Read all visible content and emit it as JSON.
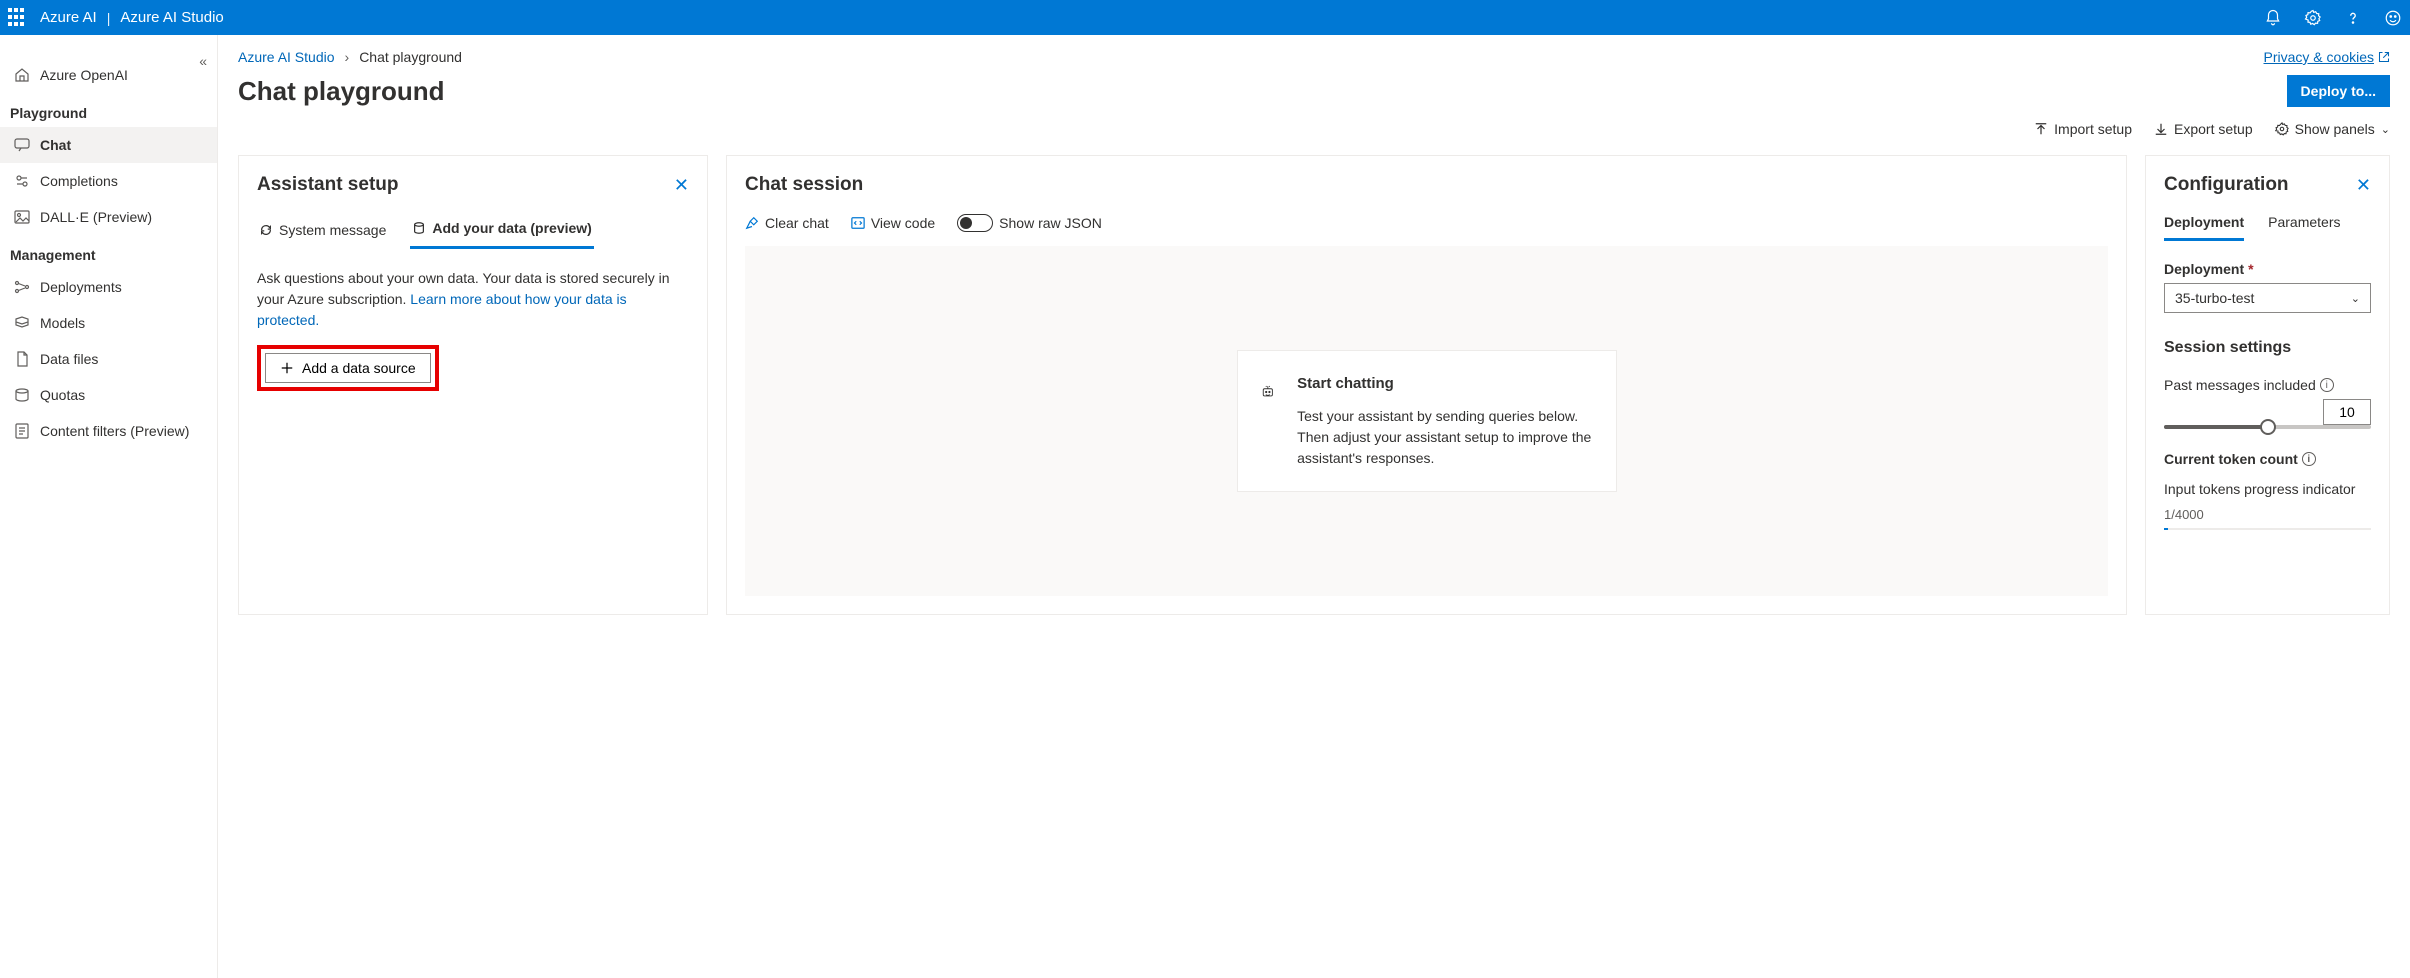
{
  "topbar": {
    "brand_left": "Azure AI",
    "brand_right": "Azure AI Studio"
  },
  "sidebar": {
    "openai": "Azure OpenAI",
    "heading_playground": "Playground",
    "items_playground": [
      {
        "label": "Chat"
      },
      {
        "label": "Completions"
      },
      {
        "label": "DALL·E (Preview)"
      }
    ],
    "heading_management": "Management",
    "items_management": [
      {
        "label": "Deployments"
      },
      {
        "label": "Models"
      },
      {
        "label": "Data files"
      },
      {
        "label": "Quotas"
      },
      {
        "label": "Content filters (Preview)"
      }
    ]
  },
  "breadcrumb": {
    "root": "Azure AI Studio",
    "current": "Chat playground"
  },
  "page": {
    "title": "Chat playground",
    "privacy": "Privacy & cookies",
    "deploy": "Deploy to...",
    "toolbar": {
      "import": "Import setup",
      "export": "Export setup",
      "panels": "Show panels"
    }
  },
  "assistant": {
    "title": "Assistant setup",
    "tab_system": "System message",
    "tab_data": "Add your data (preview)",
    "desc1": "Ask questions about your own data. Your data is stored securely in your Azure subscription. ",
    "desc_link": "Learn more about how your data is protected.",
    "add_btn": "Add a data source"
  },
  "chat": {
    "title": "Chat session",
    "clear": "Clear chat",
    "viewcode": "View code",
    "rawjson": "Show raw JSON",
    "start_h": "Start chatting",
    "start_body": "Test your assistant by sending queries below. Then adjust your assistant setup to improve the assistant's responses."
  },
  "config": {
    "title": "Configuration",
    "tab_deploy": "Deployment",
    "tab_params": "Parameters",
    "deploy_label": "Deployment",
    "deploy_value": "35-turbo-test",
    "session_h": "Session settings",
    "past_lbl": "Past messages included",
    "past_value": "10",
    "token_h": "Current token count",
    "token_desc": "Input tokens progress indicator",
    "token_frac": "1/4000"
  }
}
